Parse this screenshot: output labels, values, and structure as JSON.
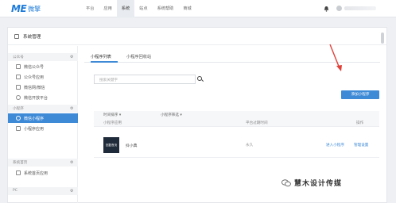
{
  "logo": {
    "mark": "ME",
    "text": "微擎"
  },
  "nav": {
    "items": [
      "平台",
      "应用",
      "系统",
      "站点",
      "系统帮助",
      "商城"
    ],
    "active_index": 2
  },
  "header": {
    "title": "系统管理"
  },
  "sidebar": {
    "sections": [
      {
        "label": "公众号",
        "items": [
          "微信公众号",
          "公众号应用",
          "微信网/微信",
          "微信开放平台"
        ]
      },
      {
        "label": "小程序",
        "items": [
          "微信小程序",
          "小程序应用"
        ]
      },
      {
        "label": "系统首页",
        "items": [
          "系统首页应用"
        ]
      },
      {
        "label": "PC",
        "items": []
      }
    ],
    "active_item": "微信小程序"
  },
  "tabs": [
    "小程序列表",
    "小程序回收站"
  ],
  "search": {
    "placeholder": "搜索关键字"
  },
  "add_button": "添加小程序",
  "filters": [
    "时间排序",
    "小程序筛选"
  ],
  "table": {
    "headers": [
      "小程序应用",
      "平台过期时间",
      "操作"
    ],
    "rows": [
      {
        "thumb_text": "回复首页",
        "name": "抖小典",
        "expiry": "永久",
        "actions": [
          "进入小程序",
          "管理设置"
        ]
      }
    ]
  },
  "watermark": "慧木设计传媒",
  "colors": {
    "accent": "#3e8ad7",
    "logo": "#1e7bd9",
    "arrow": "#e0413a"
  }
}
